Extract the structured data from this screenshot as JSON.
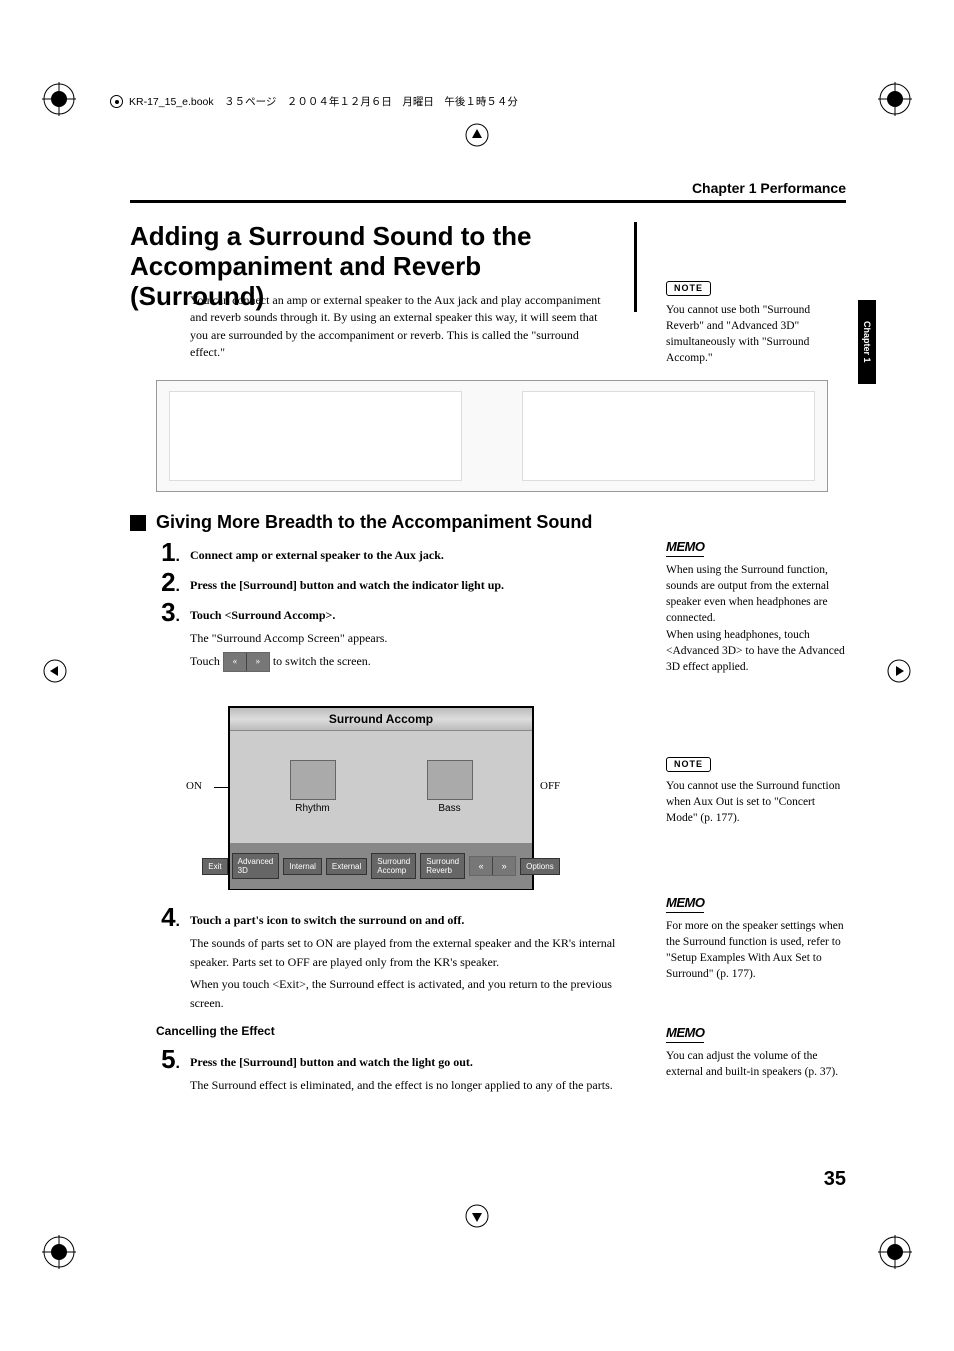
{
  "header": {
    "book_info": "KR-17_15_e.book　３５ページ　２００４年１２月６日　月曜日　午後１時５４分"
  },
  "chapter_label": "Chapter 1 Performance",
  "side_tab": "Chapter 1",
  "title": "Adding a Surround Sound to the Accompaniment and Reverb (Surround)",
  "intro": "You can connect an amp or external speaker to the Aux jack and play accompaniment and reverb sounds through it. By using an external speaker this way, it will seem that you are surrounded by the accompaniment or reverb. This is called the \"surround effect.\"",
  "note1": {
    "label": "NOTE",
    "text": "You cannot use both \"Surround Reverb\" and \"Advanced 3D\" simultaneously with \"Surround Accomp.\""
  },
  "section_heading": "Giving More Breadth to the Accompaniment Sound",
  "steps": {
    "s1": "Connect amp or external speaker to the Aux jack.",
    "s2": "Press the [Surround] button and watch the indicator light up.",
    "s3": "Touch <Surround Accomp>.",
    "s3_sub1": "The \"Surround Accomp Screen\" appears.",
    "s3_sub2a": "Touch ",
    "s3_sub2b": " to switch the screen.",
    "s4": "Touch a part's icon to switch the surround on and off.",
    "s4_sub1": "The sounds of parts set to ON are played from the external speaker and the KR's internal speaker. Parts set to OFF are played only from the KR's speaker.",
    "s4_sub2": "When you touch <Exit>, the Surround effect is activated, and you return to the previous screen.",
    "s5": "Press the [Surround] button and watch the light go out.",
    "s5_sub": "The Surround effect is eliminated, and the effect is no longer applied to any of the parts."
  },
  "cancel_heading": "Cancelling the Effect",
  "screen": {
    "title": "Surround Accomp",
    "part1": "Rhythm",
    "part2": "Bass",
    "on": "ON",
    "off": "OFF",
    "btn_exit": "Exit",
    "btn_adv3d": "Advanced 3D",
    "btn_internal": "Internal",
    "btn_external": "External",
    "btn_accomp": "Surround Accomp",
    "btn_reverb": "Surround Reverb",
    "btn_options": "Options"
  },
  "memo1": {
    "label": "MEMO",
    "text": "When using the Surround function, sounds are output from the external speaker even when headphones are connected.\nWhen using headphones, touch <Advanced 3D> to have the Advanced 3D effect applied."
  },
  "note2": {
    "label": "NOTE",
    "text": "You cannot use the Surround function when Aux Out is set to \"Concert Mode\" (p. 177)."
  },
  "memo2": {
    "label": "MEMO",
    "text": "For more on the speaker settings when the Surround function is used, refer to \"Setup Examples With Aux Set to Surround\" (p. 177)."
  },
  "memo3": {
    "label": "MEMO",
    "text": "You can adjust the volume of the external and built-in speakers (p. 37)."
  },
  "page_number": "35",
  "arrows": {
    "left": "«",
    "right": "»"
  }
}
